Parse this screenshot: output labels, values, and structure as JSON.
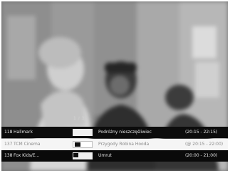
{
  "osd": {
    "counter": "1 / 3",
    "channels": [
      {
        "number": "118",
        "name": "Hallmark",
        "program": "Podróżny nieszczęśliwiec",
        "time": "(20:15 - 22:15)"
      },
      {
        "number": "137",
        "name": "TCM Cinema",
        "program": "Przygody Robina Hooda",
        "time": "(@ 20:15 - 22:00)"
      },
      {
        "number": "138",
        "name": "Fox Kids/E...",
        "program": "Umrut",
        "time": "(20:00 - 21:00)"
      }
    ]
  }
}
